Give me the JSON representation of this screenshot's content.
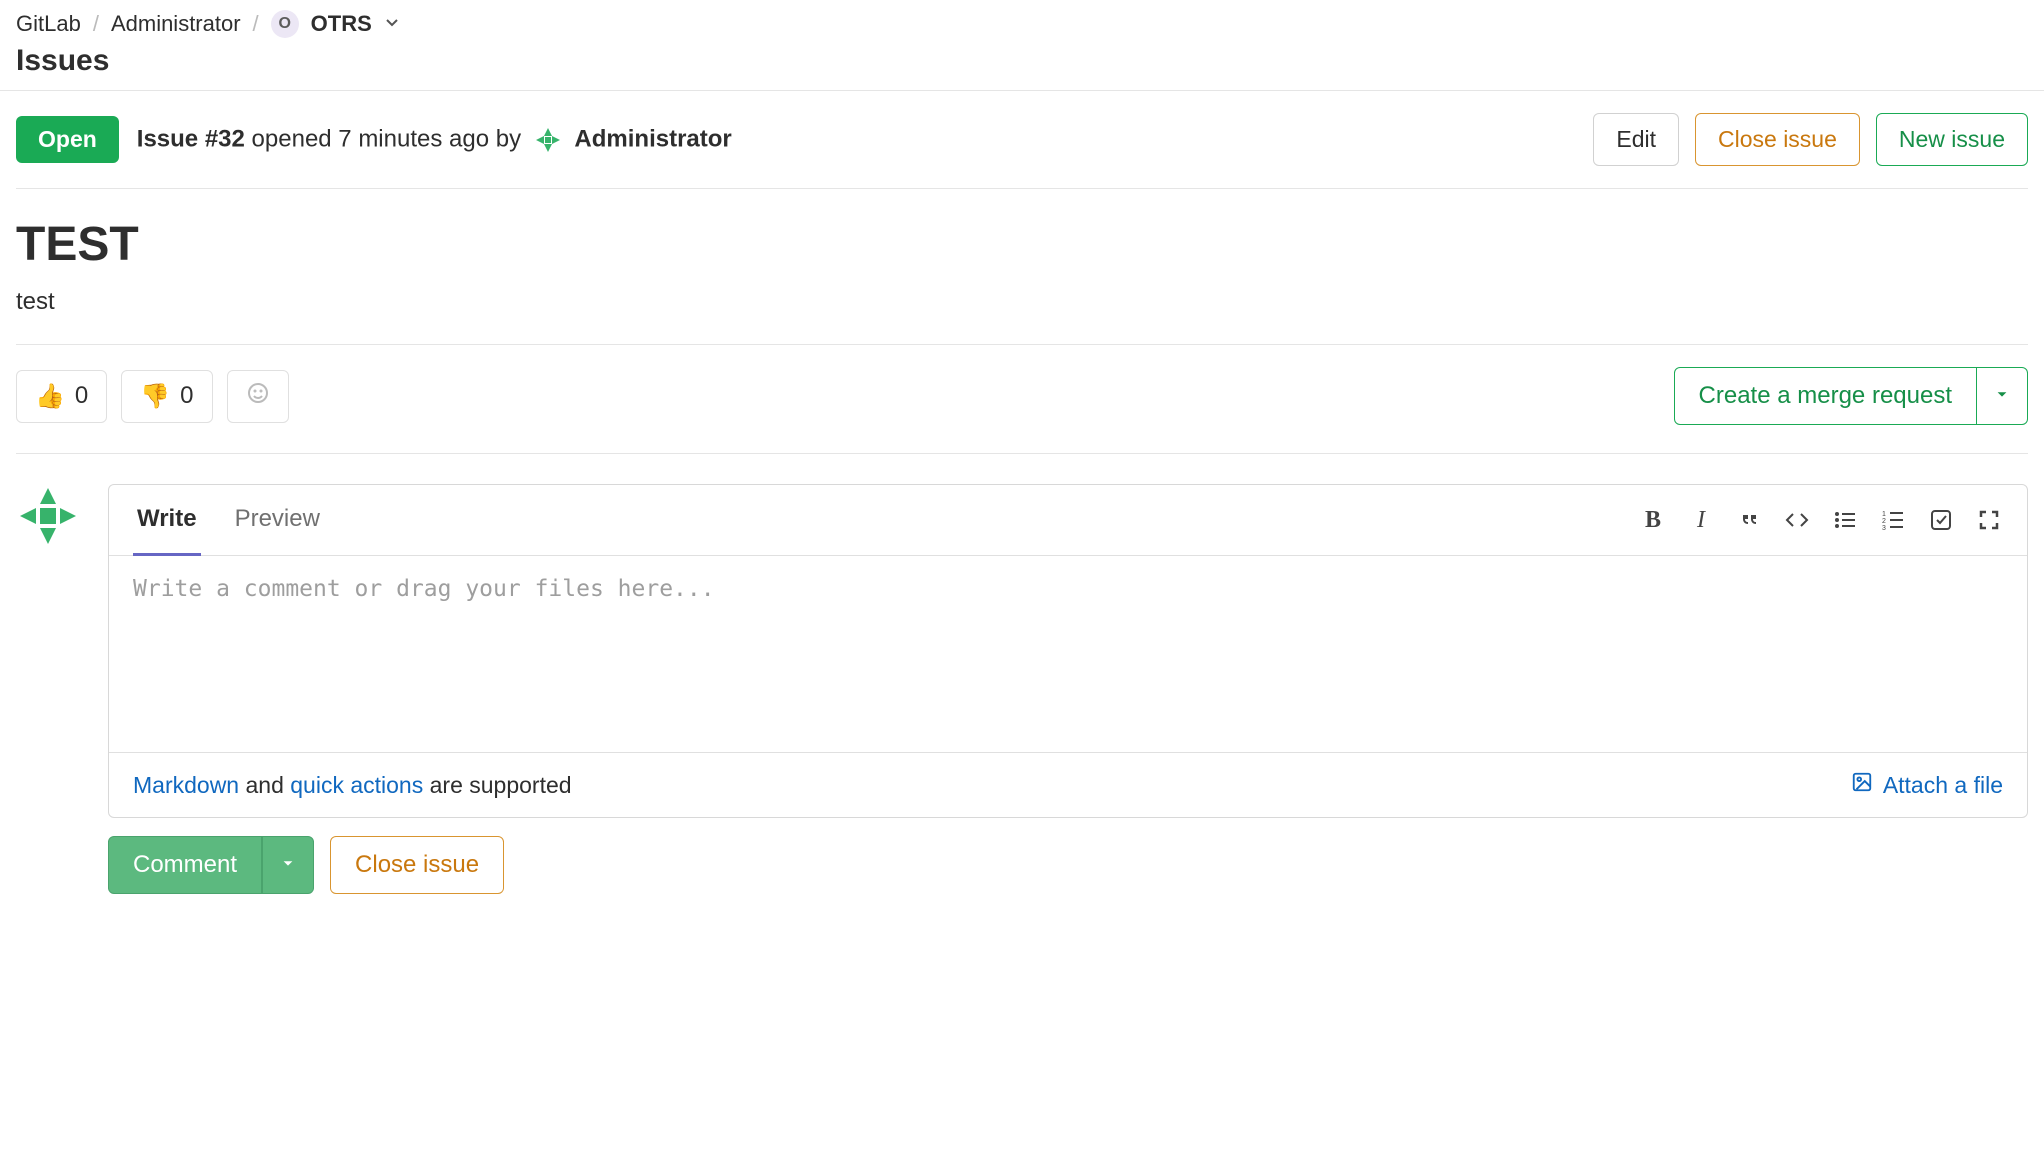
{
  "breadcrumbs": {
    "root": "GitLab",
    "group": "Administrator",
    "project_initial": "O",
    "project": "OTRS"
  },
  "page_section": "Issues",
  "status": {
    "state": "Open",
    "issue_ref": "Issue #32",
    "opened_text": "opened 7 minutes ago by",
    "author": "Administrator"
  },
  "actions": {
    "edit": "Edit",
    "close": "Close issue",
    "new": "New issue"
  },
  "issue": {
    "title": "TEST",
    "description": "test"
  },
  "reactions": {
    "thumbs_up": {
      "emoji": "👍",
      "count": "0"
    },
    "thumbs_down": {
      "emoji": "👎",
      "count": "0"
    }
  },
  "merge_request_btn": "Create a merge request",
  "comment": {
    "tab_write": "Write",
    "tab_preview": "Preview",
    "placeholder": "Write a comment or drag your files here...",
    "markdown_link": "Markdown",
    "and_text": " and ",
    "quick_actions_link": "quick actions",
    "supported_text": " are supported",
    "attach": "Attach a file",
    "submit": "Comment",
    "close": "Close issue"
  }
}
